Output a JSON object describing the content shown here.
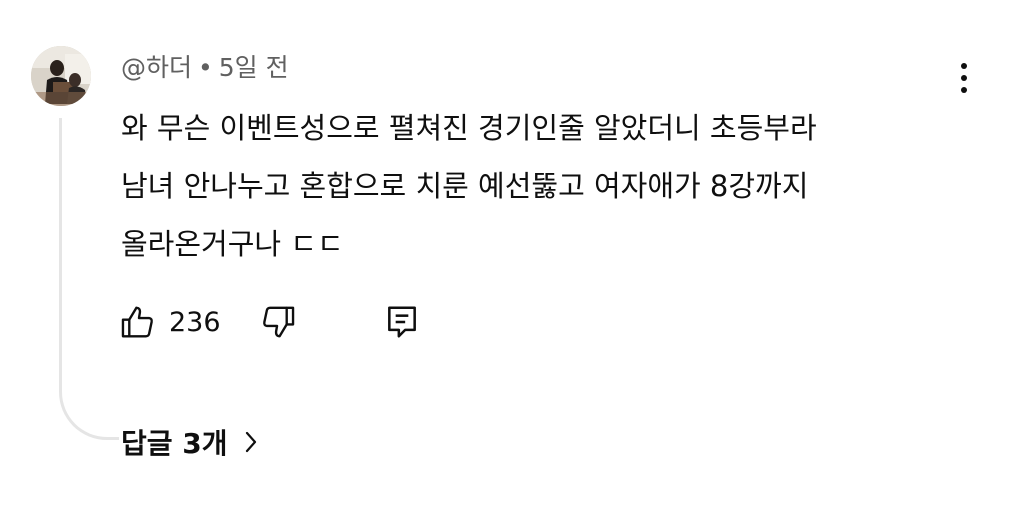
{
  "comment": {
    "author": "@하더",
    "separator": "•",
    "time": "5일 전",
    "text_lines": [
      "와 무슨 이벤트성으로 펼쳐진 경기인줄 알았더니 초등부라",
      "남녀 안나누고 혼합으로 치룬 예선뚫고 여자애가 8강까지",
      "올라온거구나 ㄷㄷ"
    ]
  },
  "actions": {
    "like_count": "236"
  },
  "replies": {
    "label": "답글 3개"
  },
  "icons": {
    "more": "more-vert-icon",
    "like": "thumb-up-icon",
    "dislike": "thumb-down-icon",
    "reply": "comment-reply-icon",
    "chevron": "chevron-right-icon"
  }
}
